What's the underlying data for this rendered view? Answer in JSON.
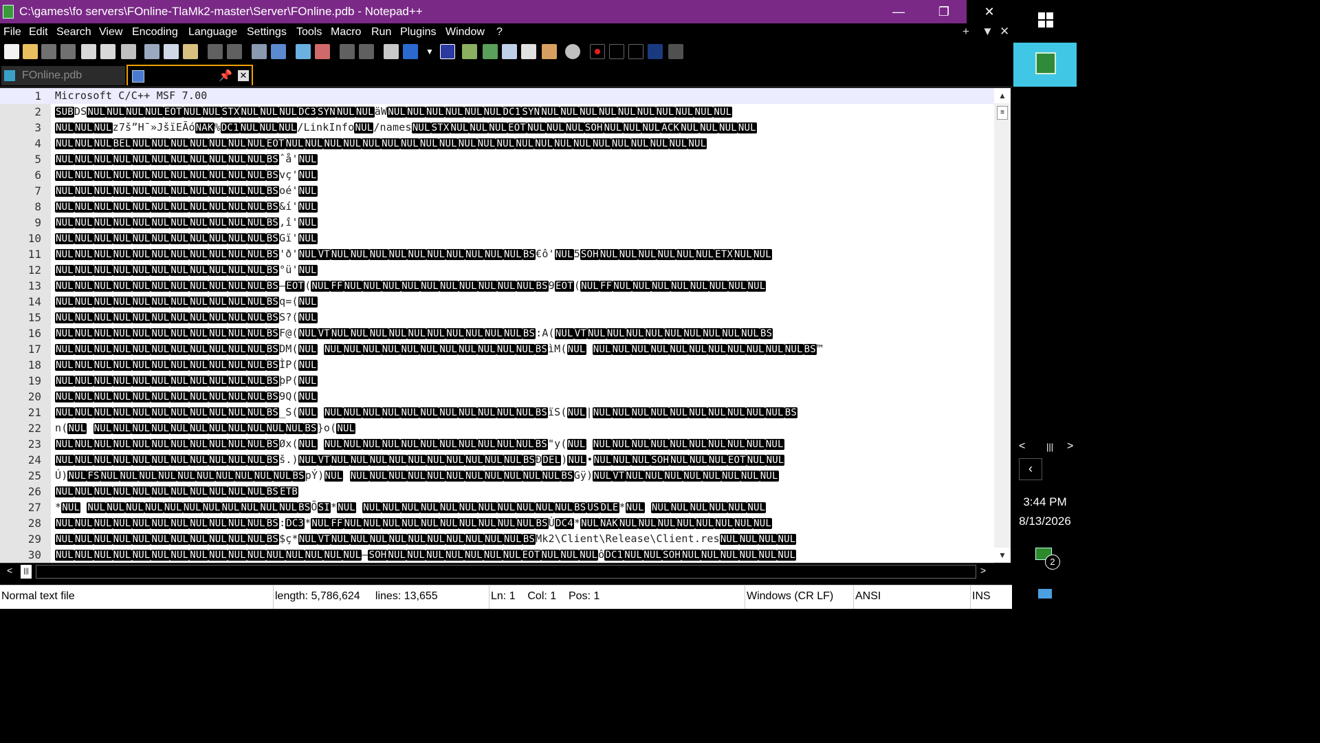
{
  "window": {
    "title": "C:\\games\\fo servers\\FOnline-TlaMk2-master\\Server\\FOnline.pdb - Notepad++",
    "minimize": "—",
    "restore": "❐",
    "close": "✕"
  },
  "menu": {
    "items": [
      "File",
      "Edit",
      "Search",
      "View",
      "Encoding",
      "Language",
      "Settings",
      "Tools",
      "Macro",
      "Run",
      "Plugins",
      "Window",
      "?"
    ],
    "right_controls": [
      "+",
      "▼",
      "✕"
    ]
  },
  "tabs": [
    {
      "label": "FOnline.pdb",
      "active": false
    },
    {
      "label": "",
      "active": true,
      "pin": "📌",
      "close": "✕"
    }
  ],
  "editor": {
    "lines": [
      {
        "n": "1",
        "text": "Microsoft C/C++ MSF 7.00"
      },
      {
        "n": "2",
        "text": "[SUB]DS[NUL][NUL][NUL][NUL][EOT][NUL][NUL][STX][NUL][NUL][NUL][DC3][SYN][NUL][NUL]äW[NUL][NUL][NUL][NUL][NUL][NUL][DC1][SYN][NUL][NUL][NUL][NUL][NUL][NUL][NUL][NUL][NUL][NUL]"
      },
      {
        "n": "3",
        "text": "[NUL][NUL][NUL]z7š”H¯»JšïEÃó[NAK]%[DC1][NUL][NUL][NUL]/LinkInfo[NUL]/names[NUL][STX][NUL][NUL][NUL][EOT][NUL][NUL][NUL][SOH][NUL][NUL][NUL][ACK][NUL][NUL][NUL][NUL]"
      },
      {
        "n": "4",
        "text": "[NUL][NUL][NUL][BEL][NUL][NUL][NUL][NUL][NUL][NUL][NUL][EOT][NUL][NUL][NUL][NUL][NUL][NUL][NUL][NUL][NUL][NUL][NUL][NUL][NUL][NUL][NUL][NUL][NUL][NUL][NUL][NUL][NUL][NUL]"
      },
      {
        "n": "5",
        "text": "[NUL][NUL][NUL][NUL][NUL][NUL][NUL][NUL][NUL][NUL][NUL][BS]ˆå'[NUL]"
      },
      {
        "n": "6",
        "text": "[NUL][NUL][NUL][NUL][NUL][NUL][NUL][NUL][NUL][NUL][NUL][BS]vç'[NUL]"
      },
      {
        "n": "7",
        "text": "[NUL][NUL][NUL][NUL][NUL][NUL][NUL][NUL][NUL][NUL][NUL][BS]oé'[NUL]"
      },
      {
        "n": "8",
        "text": "[NUL][NUL][NUL][NUL][NUL][NUL][NUL][NUL][NUL][NUL][NUL][BS]&í'[NUL]"
      },
      {
        "n": "9",
        "text": "[NUL][NUL][NUL][NUL][NUL][NUL][NUL][NUL][NUL][NUL][NUL][BS],î'[NUL]"
      },
      {
        "n": "10",
        "text": "[NUL][NUL][NUL][NUL][NUL][NUL][NUL][NUL][NUL][NUL][NUL][BS]Gï'[NUL]"
      },
      {
        "n": "11",
        "text": "[NUL][NUL][NUL][NUL][NUL][NUL][NUL][NUL][NUL][NUL][NUL][BS]'ð'[NUL][VT][NUL][NUL][NUL][NUL][NUL][NUL][NUL][NUL][NUL][NUL][BS]€ô'[NUL]5[SOH][NUL][NUL][NUL][NUL][NUL][NUL][ETX][NUL][NUL]"
      },
      {
        "n": "12",
        "text": "[NUL][NUL][NUL][NUL][NUL][NUL][NUL][NUL][NUL][NUL][NUL][BS]°ü'[NUL]"
      },
      {
        "n": "13",
        "text": "[NUL][NUL][NUL][NUL][NUL][NUL][NUL][NUL][NUL][NUL][NUL][BS]–[EOT]([NUL][FF][NUL][NUL][NUL][NUL][NUL][NUL][NUL][NUL][NUL][NUL][BS]9[EOT]([NUL][FF][NUL][NUL][NUL][NUL][NUL][NUL][NUL][NUL]"
      },
      {
        "n": "14",
        "text": "[NUL][NUL][NUL][NUL][NUL][NUL][NUL][NUL][NUL][NUL][NUL][BS]q=([NUL]"
      },
      {
        "n": "15",
        "text": "[NUL][NUL][NUL][NUL][NUL][NUL][NUL][NUL][NUL][NUL][NUL][BS]S?([NUL]"
      },
      {
        "n": "16",
        "text": "[NUL][NUL][NUL][NUL][NUL][NUL][NUL][NUL][NUL][NUL][NUL][BS]F@([NUL][VT][NUL][NUL][NUL][NUL][NUL][NUL][NUL][NUL][NUL][NUL][BS]:A([NUL][VT][NUL][NUL][NUL][NUL][NUL][NUL][NUL][NUL][NUL][BS]"
      },
      {
        "n": "17",
        "text": "[NUL][NUL][NUL][NUL][NUL][NUL][NUL][NUL][NUL][NUL][NUL][BS]DM([NUL] [NUL][NUL][NUL][NUL][NUL][NUL][NUL][NUL][NUL][NUL][NUL][BS]ìM([NUL]  [NUL][NUL][NUL][NUL][NUL][NUL][NUL][NUL][NUL][NUL][NUL][BS]™"
      },
      {
        "n": "18",
        "text": "[NUL][NUL][NUL][NUL][NUL][NUL][NUL][NUL][NUL][NUL][NUL][BS]ÌP([NUL]"
      },
      {
        "n": "19",
        "text": "[NUL][NUL][NUL][NUL][NUL][NUL][NUL][NUL][NUL][NUL][NUL][BS]þP([NUL]"
      },
      {
        "n": "20",
        "text": "[NUL][NUL][NUL][NUL][NUL][NUL][NUL][NUL][NUL][NUL][NUL][BS]9Q([NUL]"
      },
      {
        "n": "21",
        "text": "[NUL][NUL][NUL][NUL][NUL][NUL][NUL][NUL][NUL][NUL][NUL][BS]_S([NUL]   [NUL][NUL][NUL][NUL][NUL][NUL][NUL][NUL][NUL][NUL][NUL][BS]ïS([NUL]|[NUL][NUL][NUL][NUL][NUL][NUL][NUL][NUL][NUL][NUL][BS]"
      },
      {
        "n": "22",
        "text": "n([NUL]  [NUL][NUL][NUL][NUL][NUL][NUL][NUL][NUL][NUL][NUL][NUL][BS]}o([NUL]"
      },
      {
        "n": "23",
        "text": "[NUL][NUL][NUL][NUL][NUL][NUL][NUL][NUL][NUL][NUL][NUL][BS]Øx([NUL]   [NUL][NUL][NUL][NUL][NUL][NUL][NUL][NUL][NUL][NUL][NUL][BS]\"y([NUL]   [NUL][NUL][NUL][NUL][NUL][NUL][NUL][NUL][NUL][NUL]"
      },
      {
        "n": "24",
        "text": "[NUL][NUL][NUL][NUL][NUL][NUL][NUL][NUL][NUL][NUL][NUL][BS]š.)[NUL][VT][NUL][NUL][NUL][NUL][NUL][NUL][NUL][NUL][NUL][NUL][BS]Ð[DEL])[NUL]•[NUL][NUL][NUL][SOH][NUL][NUL][NUL][EOT][NUL][NUL]"
      },
      {
        "n": "25",
        "text": "Ú)[NUL][FS][NUL][NUL][NUL][NUL][NUL][NUL][NUL][NUL][NUL][NUL][BS]pÝ)[NUL]    [NUL][NUL][NUL][NUL][NUL][NUL][NUL][NUL][NUL][NUL][NUL][BS]Gÿ)[NUL][VT][NUL][NUL][NUL][NUL][NUL][NUL][NUL][NUL]"
      },
      {
        "n": "26",
        "text": "[NUL][NUL][NUL][NUL][NUL][NUL][NUL][NUL][NUL][NUL][NUL][BS][ETB]"
      },
      {
        "n": "27",
        "text": "*[NUL]  [NUL][NUL][NUL][NUL][NUL][NUL][NUL][NUL][NUL][NUL][NUL][BS]Õ[SI]*[NUL]  [NUL][NUL][NUL][NUL][NUL][NUL][NUL][NUL][NUL][NUL][NUL][BS][US][DLE]*[NUL]   [NUL][NUL][NUL][NUL][NUL][NUL]"
      },
      {
        "n": "28",
        "text": "[NUL][NUL][NUL][NUL][NUL][NUL][NUL][NUL][NUL][NUL][NUL][BS]:[DC3]*[NUL][FF][NUL][NUL][NUL][NUL][NUL][NUL][NUL][NUL][NUL][NUL][BS]Ù[DC4]*[NUL][NAK][NUL][NUL][NUL][NUL][NUL][NUL][NUL][NUL]"
      },
      {
        "n": "29",
        "text": "[NUL][NUL][NUL][NUL][NUL][NUL][NUL][NUL][NUL][NUL][NUL][BS]$ç*[NUL][VT][NUL][NUL][NUL][NUL][NUL][NUL][NUL][NUL][NUL][NUL][BS]Mk2\\Client\\Release\\Client.res[NUL][NUL][NUL][NUL]"
      },
      {
        "n": "30",
        "text": "[NUL][NUL][NUL][NUL][NUL][NUL][NUL][NUL][NUL][NUL][NUL][NUL][NUL][NUL][NUL][NUL]–[SOH][NUL][NUL][NUL][NUL][NUL][NUL][NUL][EOT][NUL][NUL][NUL]ô[DC1][NUL][NUL][SOH][NUL][NUL][NUL][NUL][NUL][NUL]"
      }
    ]
  },
  "status": {
    "file_type": "Normal text file",
    "length": "length: 5,786,624",
    "lines": "lines: 13,655",
    "ln": "Ln: 1",
    "col": "Col: 1",
    "pos": "Pos: 1",
    "eol": "Windows (CR LF)",
    "encoding": "ANSI",
    "mode": "INS"
  },
  "taskbar": {
    "time": "3:44 PM",
    "date": "8/13/2026",
    "notifications": "2",
    "colors": {
      "title_bar": "#7a2a86",
      "active_tile": "#41c7e6"
    }
  }
}
